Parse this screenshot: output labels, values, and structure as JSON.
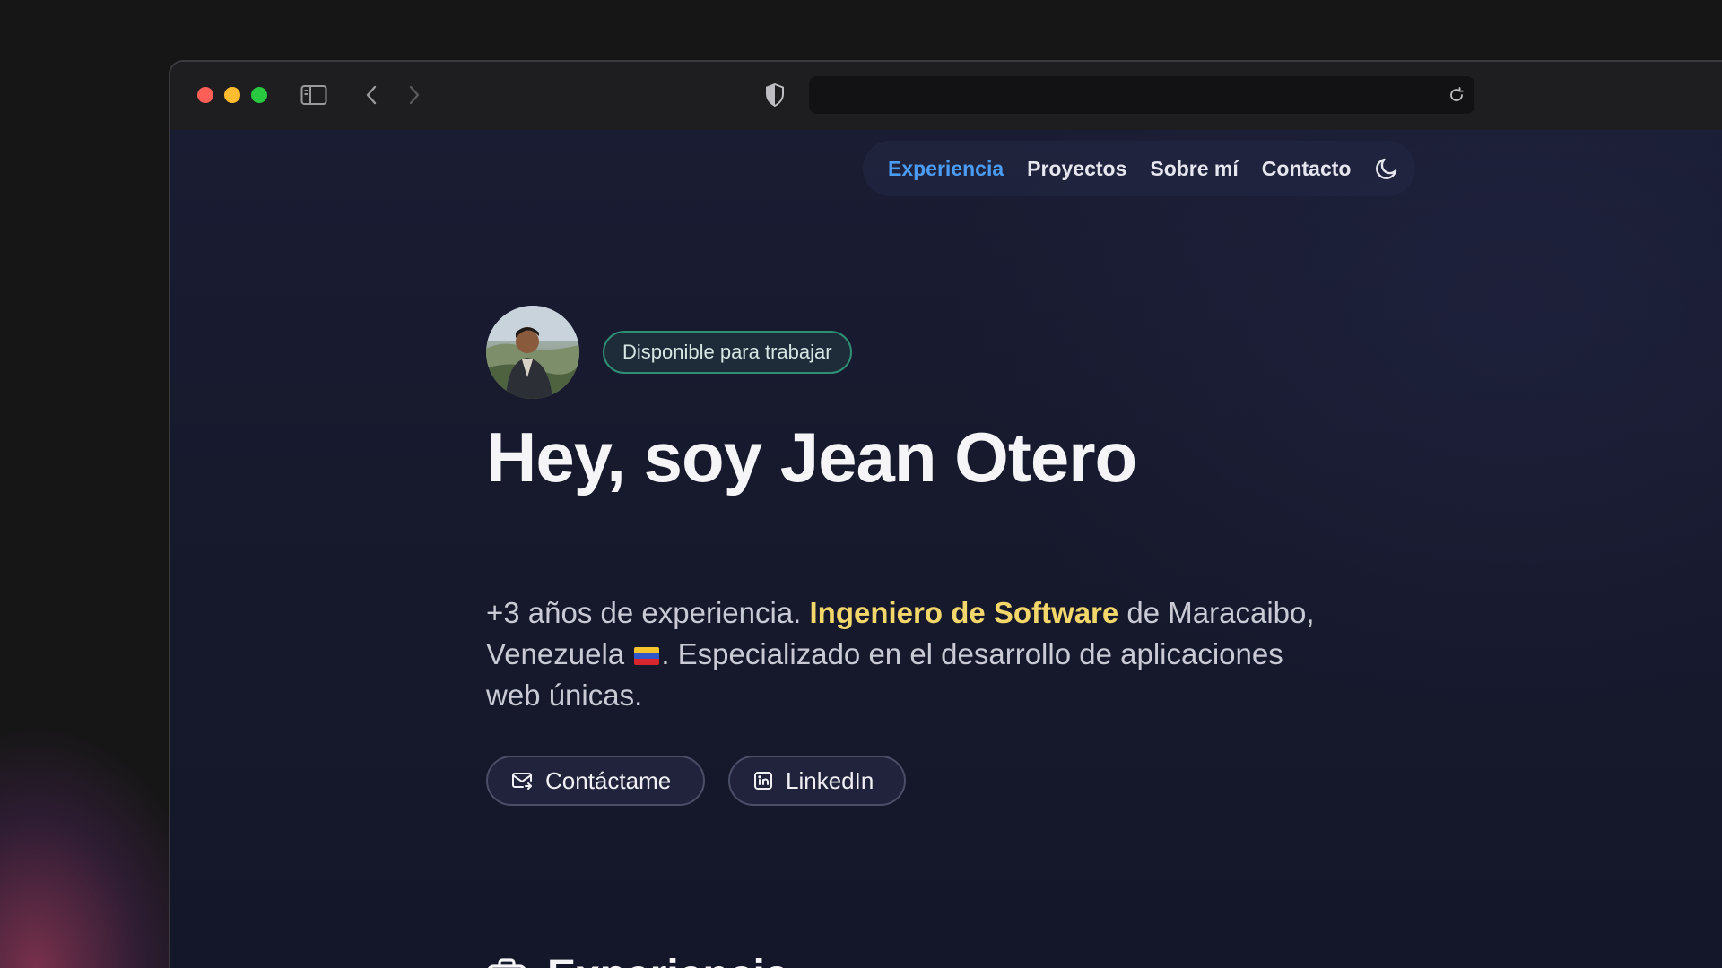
{
  "nav": {
    "items": [
      {
        "label": "Experiencia",
        "active": true
      },
      {
        "label": "Proyectos",
        "active": false
      },
      {
        "label": "Sobre mí",
        "active": false
      },
      {
        "label": "Contacto",
        "active": false
      }
    ],
    "theme_icon": "moon-icon"
  },
  "hero": {
    "badge": "Disponible para trabajar",
    "title": "Hey, soy Jean Otero",
    "desc_part1": "+3 años de experiencia.",
    "desc_highlight": "Ingeniero de Software",
    "desc_part2": "de Maracaibo, Venezuela",
    "desc_part3": ". Especializado en el desarrollo de aplicaciones web únicas.",
    "buttons": {
      "contact": "Contáctame",
      "linkedin": "LinkedIn"
    }
  },
  "section": {
    "title": "Experiencia",
    "icon": "briefcase-icon"
  },
  "colors": {
    "accent": "#4b9cf5",
    "highlight": "#f3d76a",
    "badge_border": "#2f8f75"
  }
}
